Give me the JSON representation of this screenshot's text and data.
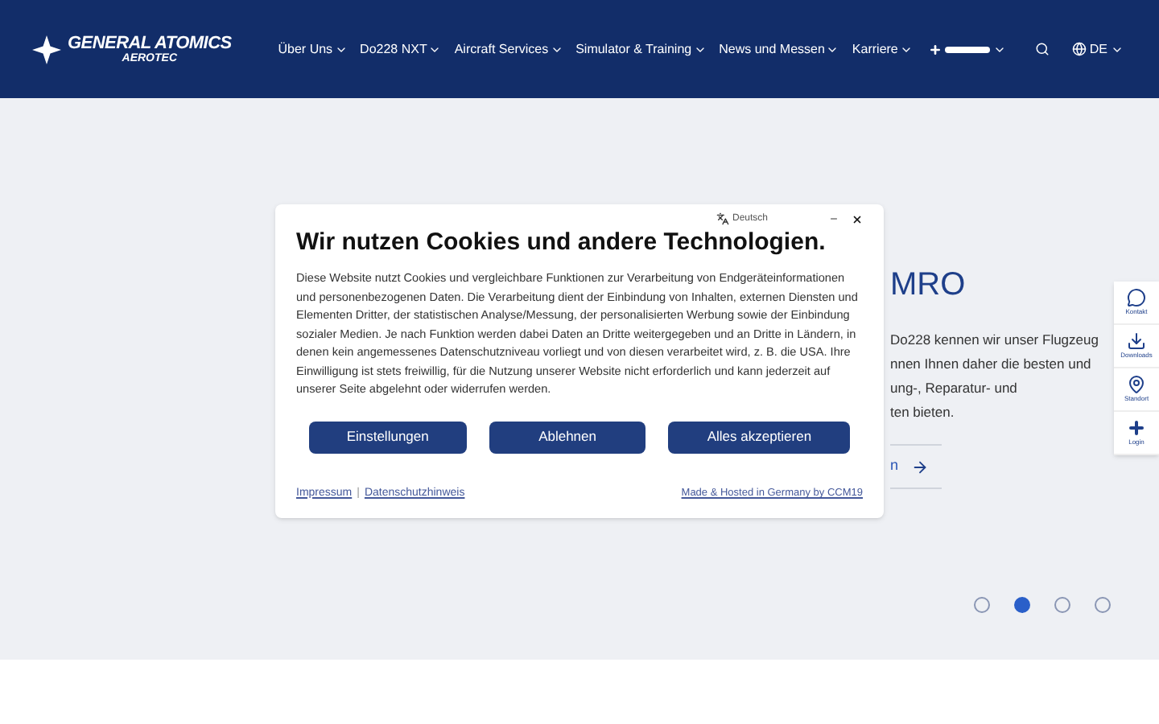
{
  "header": {
    "logo": {
      "line1": "GENERAL ATOMICS",
      "line2": "AEROTEC"
    },
    "nav": [
      {
        "label": "Über Uns"
      },
      {
        "label": "Do228 NXT"
      },
      {
        "label": "Aircraft Services"
      },
      {
        "label": "Simulator & Training"
      },
      {
        "label": "News und Messen"
      },
      {
        "label": "Karriere"
      }
    ],
    "language": "DE"
  },
  "hero": {
    "title": "MRO",
    "lines": [
      "Do228 kennen wir unser Flugzeug",
      "nnen Ihnen daher die besten und",
      "ung-, Reparatur- und",
      "ten bieten."
    ],
    "link": "n",
    "slides": [
      {
        "selected": false
      },
      {
        "selected": true
      },
      {
        "selected": false
      },
      {
        "selected": false
      }
    ]
  },
  "side_widget": [
    {
      "kind": "chat",
      "label": "Kontakt"
    },
    {
      "kind": "download",
      "label": "Downloads"
    },
    {
      "kind": "pin",
      "label": "Standort"
    },
    {
      "kind": "logo",
      "label": "Login"
    }
  ],
  "cookie_dialog": {
    "language": "Deutsch",
    "title": "Wir nutzen Cookies und andere Technologien.",
    "text": "Diese Website nutzt Cookies und vergleichbare Funktionen zur Verarbeitung von Endgeräteinformationen und personenbezogenen Daten. Die Verarbeitung dient der Einbindung von Inhalten, externen Diensten und Elementen Dritter, der statistischen Analyse/Messung, der personalisierten Werbung sowie der Einbindung sozialer Medien. Je nach Funktion werden dabei Daten an Dritte weitergegeben und an Dritte in Ländern, in denen kein angemessenes Datenschutzniveau vorliegt und von diesen verarbeitet wird, z. B. die USA. Ihre Einwilligung ist stets freiwillig, für die Nutzung unserer Website nicht erforderlich und kann jederzeit auf unserer Seite abgelehnt oder widerrufen werden.",
    "buttons": [
      "Einstellungen",
      "Ablehnen",
      "Alles akzeptieren"
    ],
    "footer_links": [
      "Impressum",
      "Datenschutzhinweis"
    ],
    "separator": "|",
    "credit": "Made & Hosted in Germany by CCM19"
  }
}
